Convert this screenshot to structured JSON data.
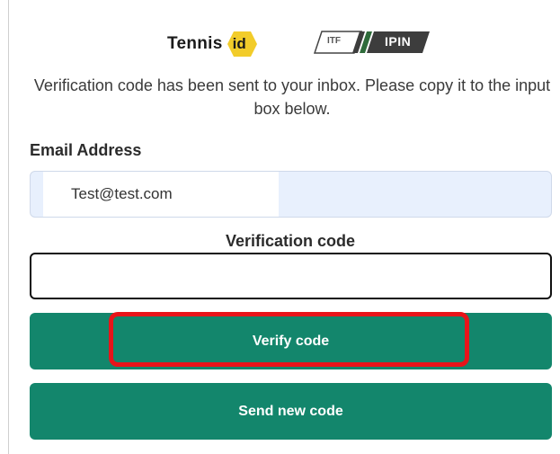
{
  "header": {
    "tennis_brand": "Tennis",
    "tennis_badge": "id",
    "ipin_itf": "ITF",
    "ipin_label": "IPIN"
  },
  "message": "Verification code has been sent to your inbox. Please copy it to the input box below.",
  "email": {
    "label": "Email Address",
    "value": "Test@test.com"
  },
  "verification": {
    "label": "Verification code",
    "value": ""
  },
  "buttons": {
    "verify_label": "Verify code",
    "send_new_label": "Send new code"
  },
  "colors": {
    "button_green": "#13866c",
    "highlight_red": "#e8141a",
    "autofill_blue": "#e8f0fd",
    "badge_yellow": "#f2cc2a"
  }
}
